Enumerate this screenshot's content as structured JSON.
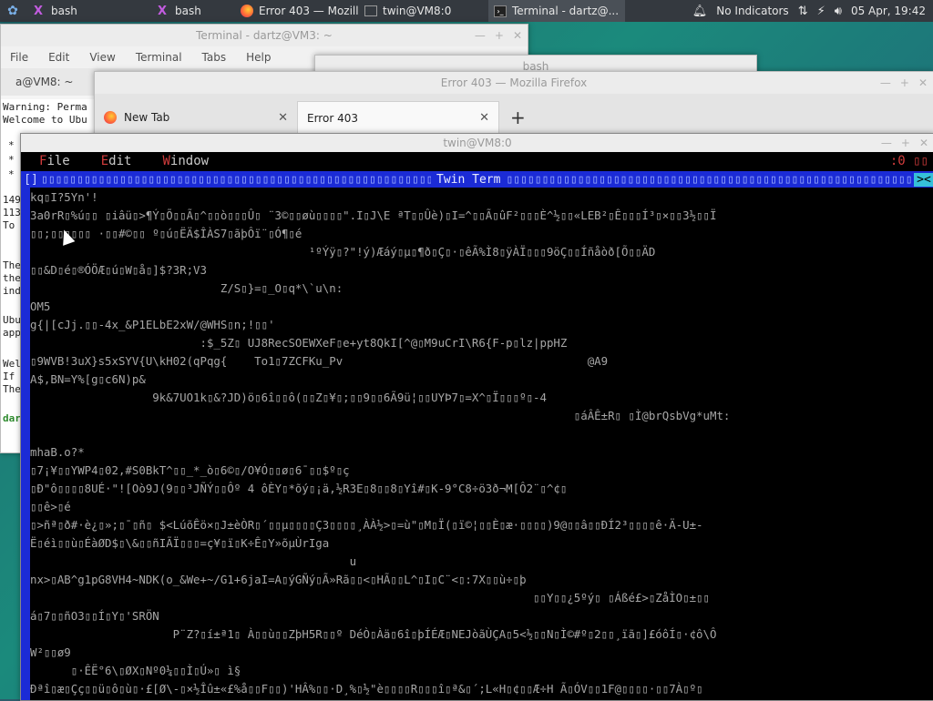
{
  "panel": {
    "tasks": [
      {
        "icon": "X",
        "label": "bash"
      },
      {
        "icon": "X",
        "label": "bash"
      },
      {
        "icon": "firefox",
        "label": "Error 403 — Mozill..."
      },
      {
        "icon": "window",
        "label": "twin@VM8:0"
      },
      {
        "icon": "terminal",
        "label": "Terminal - dartz@..."
      }
    ],
    "indicators": "No Indicators",
    "clock": "05 Apr, 19:42"
  },
  "dartz": {
    "title": "Terminal - dartz@VM3: ~",
    "menu": [
      "File",
      "Edit",
      "View",
      "Terminal",
      "Tabs",
      "Help"
    ],
    "tab": "a@VM8: ~",
    "lines": [
      "Warning: Perma",
      "Welcome to Ubu",
      "*",
      "*",
      "*",
      "149",
      "113",
      "To",
      "The",
      "the",
      "ind",
      "Ubu",
      "app",
      "Wel",
      "If",
      "The",
      "dar"
    ]
  },
  "bash": {
    "title": "bash"
  },
  "firefox": {
    "title": "Error 403 — Mozilla Firefox",
    "tabs": [
      "New Tab",
      "Error 403"
    ],
    "new_tab": "+"
  },
  "twin": {
    "title": "twin@VM8:0",
    "menu": {
      "file": "File",
      "edit": "Edit",
      "window": "Window",
      "right": ":0 ▯▯"
    },
    "bar_left": "[]",
    "bar_title": "Twin Term",
    "bar_right": "><",
    "box_fill": "▯▯▯▯▯▯▯▯▯▯▯▯▯▯▯▯▯▯▯▯▯▯▯▯▯▯▯▯▯▯▯▯▯▯▯▯▯▯▯▯▯▯▯▯▯▯▯▯▯▯▯▯▯▯▯▯▯▯▯▯▯▯▯▯▯▯▯▯",
    "lines": [
      "kq▯I?5Yn'!",
      "3a0rR▯%ú▯▯ ▯iâü▯>¶Ý▯Õ▯▯Ã▯^▯▯ò▯▯▯Û▯ ¨3©▯▯øù▯▯▯▯\".I▯J\\E ªT▯▯Ûè)▯I=^▯▯Ã▯ûF²▯▯▯È^½▯▯«LEB²▯Ê▯▯▯Í³▯×▯▯3½▯▯Ï",
      "▯▯;▯▯▯▯▯▯ ·▯▯#©▯▯ º▯ú▯ËÄ$ÎÀS7▯ãþÔï¨▯Ó¶▯é",
      "                                         ¹ºÝÿ▯?\"!ý)Æáý▯µ▯¶ð▯Ç▯·▯êÃ%Ì8▯ÿÀÏ▯▯▯9öÇ▯▯Íñåòð[Õ▯▯ÄD",
      "▯▯&D▯é▯®ÓÖÆ▯ú▯W▯å▯]$?3R;V3",
      "                            Z/S▯}=▯_O▯q*\\`u\\n:",
      "OM5",
      "g{|[cJj.▯▯-4x_&P1ELbE2xW/@WHS▯n;!▯▯'",
      "                         :$_5Z▯ UJ8RecSOEWXeF▯e+yt8QkI[^@▯M9uCrI\\R6{F-p▯lz|ppHZ",
      "▯9WVB!3uX}s5xSYV{U\\kH02(qPqg{    To1▯7ZCFKu_Pv                                    @A9",
      "A$,BN=Y%[g▯c6N)p&",
      "                  9k&7UO1k▯&?JD)ö▯6î▯▯ô(▯▯Z▯¥▯;▯▯9▯▯6Ã9ü¦▯▯UYÞ7▯=X^▯Ï▯▯▯º▯-4",
      "                                                                                ▯áÂÊ±R▯ ▯Ì@brQsbVg*uMt:",
      "",
      "mhaB.o?*",
      "▯7¡¥▯▯YWP4▯02,#S0BkT^▯▯_*_ò▯6©▯/O¥Ó▯▯ø▯6¯▯▯$º▯ç",
      "▯Ð\"ô▯▯▯▯8UÉ·\"![Oò9J(9▯▯³JÑÝ▯▯Ôº 4 ôÈY▯*õý▯¡ä,½R3E▯8▯▯8▯Yî#▯K-9°C8÷ö3ð¬M[Ô2¨▯^¢▯",
      "▯▯ê>▯é",
      "▯>ñª▯ð#·è¿▯»;▯¯▯ñ▯ $<LúõÊö×▯J±èÒR▯´▯▯µ▯▯▯▯Ç3▯▯▯▯¸ÀÀ½>▯=ù\"▯M▯Ï(▯ï©¦▯▯È▯æ·▯▯▯▯)9@▯▯â▯▯ÐÍ2³▯▯▯▯ê·Ä-U±-",
      "Ë▯éì▯▯ù▯ÉàØD$▯\\&▯▯ñIÃÏ▯▯▯=ç¥▯ï▯K÷Ê▯Y»õµÙrIga",
      "                                               u",
      "nx>▯AB^g1pG8VH4~NDK(o_&We+~/G1+6jaI=A▯ýGÑý▯Ã»Rã▯▯<▯HÃ▯▯L^▯I▯C¨<▯:7X▯▯ù÷▯þ",
      "                                                                          ▯▯Y▯▯¿5ºý▯ ▯Áßé£>▯ZåÌO▯±▯▯",
      "á▯7▯▯ñO3▯▯Í▯Y▯'SRÖN",
      "                     P¨Z?▯í±ª1▯ À▯▯ù▯▯ZþH5R▯▯º DéÒ▯Àä▯6î▯þÍÉÆ▯NEJòãÙÇA▯5<½▯▯N▯Ì©#º▯2▯▯¸ïã▯]£óôÍ▯·¢ô\\Ô",
      "W²▯▯ø9",
      "      ▯·ÊË°6\\▯ØX▯Nº0¼▯▯Ì▯Ú»▯ ì§",
      "Ðªî▯æ▯Çç▯▯ü▯ô▯ù▯·£[Ø\\-▯×½Îû±«£%å▯▯F▯▯)'HÂ%▯▯·D¸%▯½\"è▯▯▯▯R▯▯▯î▯ª&▯´;L«H▯¢▯▯Æ÷H Ã▯ÓV▯▯1F@▯▯▯▯·▯▯7À▯º▯"
    ]
  }
}
